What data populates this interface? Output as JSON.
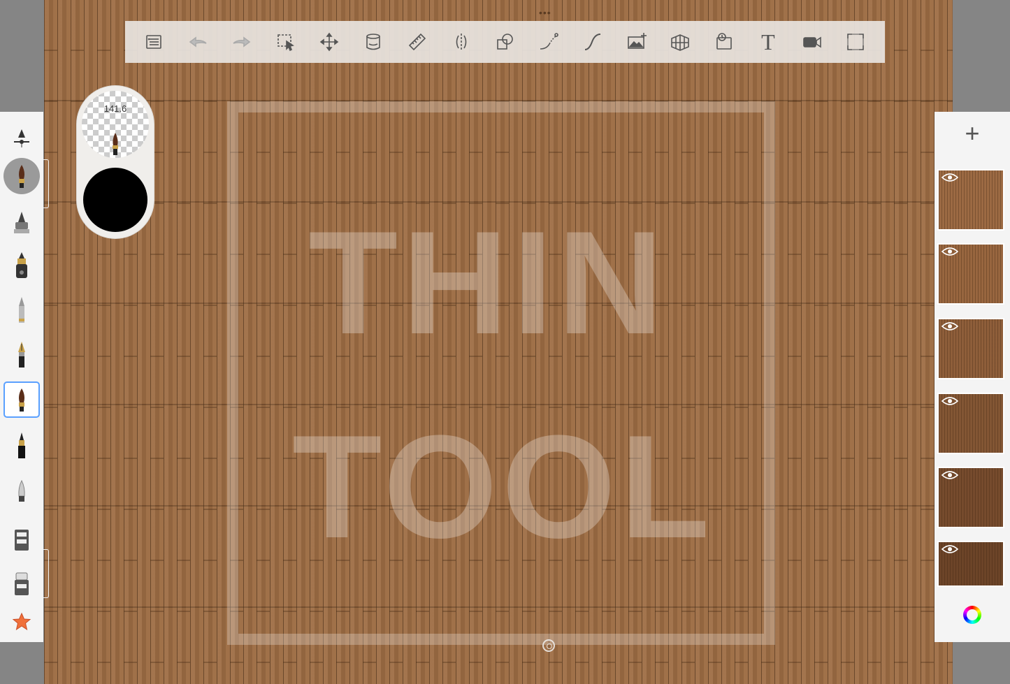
{
  "canvas": {
    "watermark_line1": "THIN",
    "watermark_line2": "TOOL",
    "top_handle": "•••"
  },
  "toolbar": {
    "items": [
      {
        "name": "gallery-list-icon"
      },
      {
        "name": "undo-icon"
      },
      {
        "name": "redo-icon"
      },
      {
        "name": "selection-icon"
      },
      {
        "name": "transform-icon"
      },
      {
        "name": "fill-bucket-icon"
      },
      {
        "name": "ruler-icon"
      },
      {
        "name": "symmetry-icon"
      },
      {
        "name": "shapes-icon"
      },
      {
        "name": "steady-stroke-icon"
      },
      {
        "name": "curve-icon"
      },
      {
        "name": "import-image-icon"
      },
      {
        "name": "perspective-guide-icon"
      },
      {
        "name": "time-lapse-icon"
      },
      {
        "name": "text-icon"
      },
      {
        "name": "video-record-icon"
      },
      {
        "name": "fullscreen-icon"
      }
    ],
    "text_tool_label": "T"
  },
  "brush_puck": {
    "size": "141.6",
    "color": "#000000"
  },
  "brushes": [
    "brush-settings-icon",
    "paint-brush-icon",
    "airbrush-icon",
    "marker-icon",
    "pencil-icon",
    "ink-pen-icon",
    "round-brush-icon",
    "fine-liner-icon",
    "soft-eraser-icon",
    "smudge-icon",
    "eraser-icon",
    "favorite-star-icon"
  ],
  "layers": {
    "add_label": "+",
    "count": 6,
    "shades": [
      "#9c6a43",
      "#98663f",
      "#8e5e3a",
      "#835634",
      "#764b2d",
      "#6c4428"
    ]
  },
  "colors": {
    "wood": "#9b6b43",
    "panel": "#f4f4f4",
    "selected_accent": "#5aa0ff"
  }
}
